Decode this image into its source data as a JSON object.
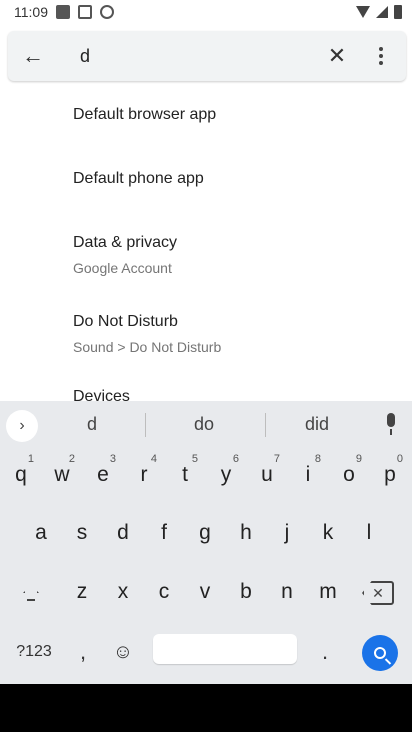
{
  "status_bar": {
    "time": "11:09"
  },
  "search": {
    "query": "d",
    "back_icon": "back-arrow-icon",
    "clear_icon": "close-icon",
    "more_icon": "more-vert-icon"
  },
  "results": [
    {
      "title": "Default browser app",
      "subtitle": ""
    },
    {
      "title": "Default phone app",
      "subtitle": ""
    },
    {
      "title": "Data & privacy",
      "subtitle": "Google Account"
    },
    {
      "title": "Do Not Disturb",
      "subtitle": "Sound > Do Not Disturb"
    },
    {
      "title": "Devices",
      "subtitle": ""
    }
  ],
  "keyboard": {
    "suggestions": [
      "d",
      "do",
      "did"
    ],
    "row1": [
      {
        "key": "q",
        "hint": "1"
      },
      {
        "key": "w",
        "hint": "2"
      },
      {
        "key": "e",
        "hint": "3"
      },
      {
        "key": "r",
        "hint": "4"
      },
      {
        "key": "t",
        "hint": "5"
      },
      {
        "key": "y",
        "hint": "6"
      },
      {
        "key": "u",
        "hint": "7"
      },
      {
        "key": "i",
        "hint": "8"
      },
      {
        "key": "o",
        "hint": "9"
      },
      {
        "key": "p",
        "hint": "0"
      }
    ],
    "row2": [
      "a",
      "s",
      "d",
      "f",
      "g",
      "h",
      "j",
      "k",
      "l"
    ],
    "row3": [
      "z",
      "x",
      "c",
      "v",
      "b",
      "n",
      "m"
    ],
    "symbols_label": "?123",
    "comma": ",",
    "period": ".",
    "accent_color": "#1a73e8"
  }
}
